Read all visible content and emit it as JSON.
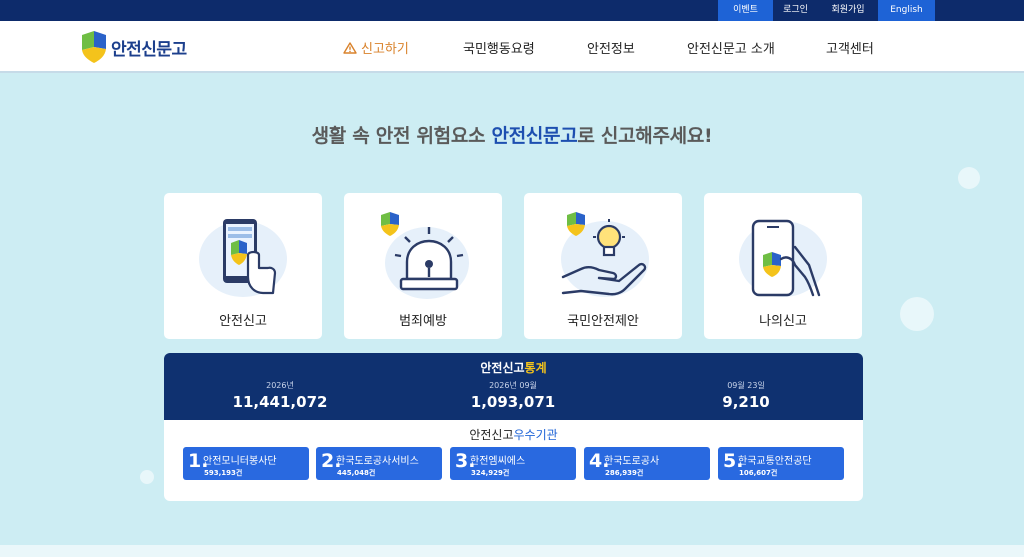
{
  "util": {
    "event": "이벤트",
    "login": "로그인",
    "join": "회원가입",
    "english": "English"
  },
  "header": {
    "logo_text": "안전신문고",
    "nav": [
      "신고하기",
      "국민행동요령",
      "안전정보",
      "안전신문고 소개",
      "고객센터"
    ]
  },
  "hero": {
    "pre": "생활 속 안전 위험요소 ",
    "highlight": "안전신문고",
    "post": "로 신고해주세요!"
  },
  "cards": [
    {
      "label": "안전신고",
      "icon": "phone-touch-icon"
    },
    {
      "label": "범죄예방",
      "icon": "siren-icon"
    },
    {
      "label": "국민안전제안",
      "icon": "lightbulb-hand-icon"
    },
    {
      "label": "나의신고",
      "icon": "phone-check-icon"
    }
  ],
  "stats": {
    "title_main": "안전신고",
    "title_accent": "통계",
    "items": [
      {
        "caption": "2026년",
        "value": "11,441,072"
      },
      {
        "caption": "2026년 09월",
        "value": "1,093,071"
      },
      {
        "caption": "09월 23일",
        "value": "9,210"
      }
    ]
  },
  "agencies": {
    "title_main": "안전신고",
    "title_accent": "우수기관",
    "items": [
      {
        "rank": "1.",
        "name": "안전모니터봉사단",
        "count": "593,193건"
      },
      {
        "rank": "2.",
        "name": "한국도로공사서비스",
        "count": "445,048건"
      },
      {
        "rank": "3.",
        "name": "한전엠씨에스",
        "count": "324,929건"
      },
      {
        "rank": "4.",
        "name": "한국도로공사",
        "count": "286,939건"
      },
      {
        "rank": "5.",
        "name": "한국교통안전공단",
        "count": "106,607건"
      }
    ]
  },
  "colors": {
    "navy": "#0d2b6b",
    "blue": "#1e63d6",
    "accent_orange": "#d9822b",
    "accent_yellow": "#f4c31b",
    "bg": "#cdedf3"
  }
}
